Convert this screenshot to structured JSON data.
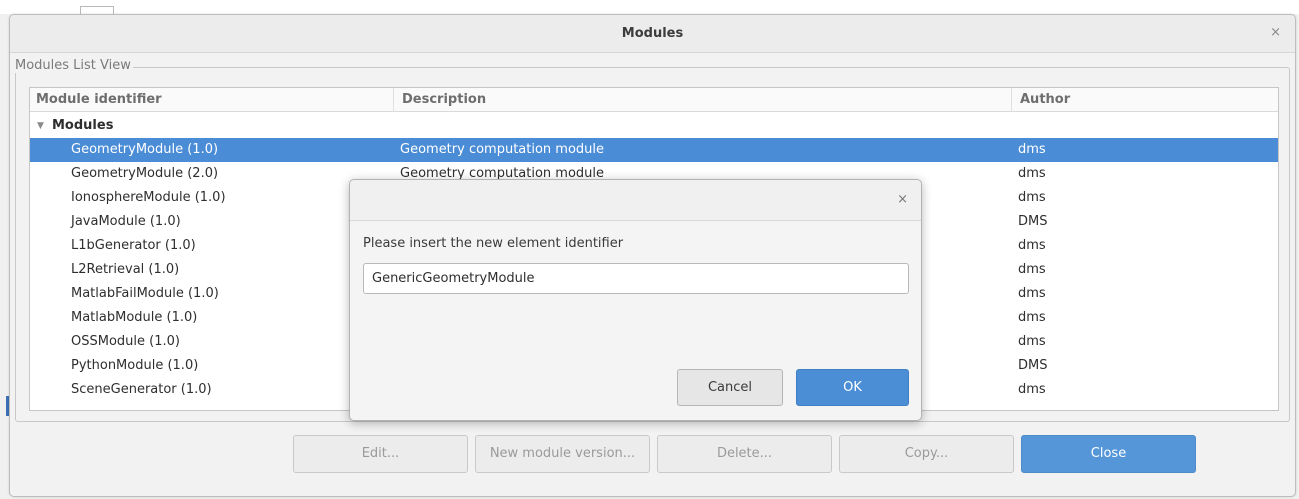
{
  "window": {
    "title": "Modules"
  },
  "group": {
    "legend": "Modules List View"
  },
  "tree": {
    "columns": [
      "Module identifier",
      "Description",
      "Author"
    ],
    "group_label": "Modules",
    "rows": [
      {
        "identifier": "GeometryModule (1.0)",
        "description": "Geometry computation module",
        "author": "dms"
      },
      {
        "identifier": "GeometryModule (2.0)",
        "description": "Geometry computation module",
        "author": "dms"
      },
      {
        "identifier": "IonosphereModule (1.0)",
        "description": "",
        "author": "dms"
      },
      {
        "identifier": "JavaModule (1.0)",
        "description": "",
        "author": "DMS"
      },
      {
        "identifier": "L1bGenerator (1.0)",
        "description": "",
        "author": "dms"
      },
      {
        "identifier": "L2Retrieval (1.0)",
        "description": "",
        "author": "dms"
      },
      {
        "identifier": "MatlabFailModule (1.0)",
        "description": "",
        "author": "dms"
      },
      {
        "identifier": "MatlabModule (1.0)",
        "description": "",
        "author": "dms"
      },
      {
        "identifier": "OSSModule (1.0)",
        "description": "",
        "author": "dms"
      },
      {
        "identifier": "PythonModule (1.0)",
        "description": "",
        "author": "DMS"
      },
      {
        "identifier": "SceneGenerator (1.0)",
        "description": "",
        "author": "dms"
      }
    ]
  },
  "buttons": {
    "edit": "Edit...",
    "new_version": "New module version...",
    "delete": "Delete...",
    "copy": "Copy...",
    "close": "Close"
  },
  "dialog": {
    "prompt": "Please insert the new element identifier",
    "input_value": "GenericGeometryModule",
    "cancel": "Cancel",
    "ok": "OK"
  },
  "colors": {
    "selection": "#4a8cd6",
    "primary_button": "#5596d8"
  },
  "icons": {
    "window_close": "close-icon",
    "dialog_close": "close-icon",
    "group_expander": "chevron-down-icon"
  }
}
